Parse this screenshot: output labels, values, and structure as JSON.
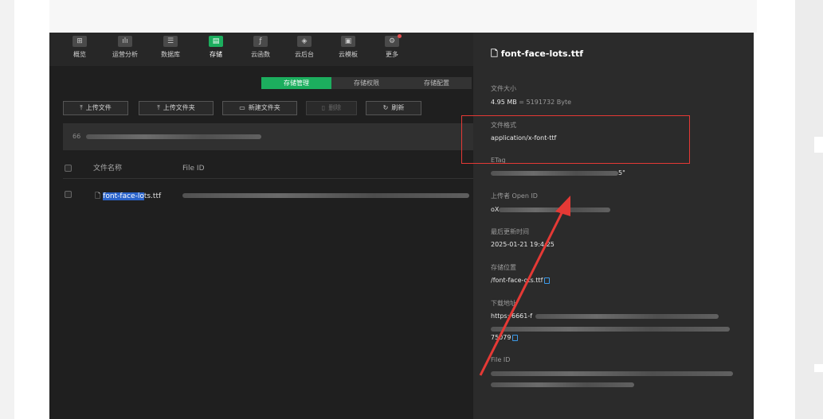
{
  "toolbar": {
    "items": [
      {
        "label": "概览",
        "icon": "grid-icon"
      },
      {
        "label": "运营分析",
        "icon": "bar-chart-icon"
      },
      {
        "label": "数据库",
        "icon": "database-icon"
      },
      {
        "label": "存储",
        "icon": "storage-icon",
        "active": true
      },
      {
        "label": "云函数",
        "icon": "function-icon"
      },
      {
        "label": "云后台",
        "icon": "cube-icon"
      },
      {
        "label": "云模板",
        "icon": "template-icon"
      },
      {
        "label": "更多",
        "icon": "more-icon"
      }
    ]
  },
  "subtabs": [
    "存储管理",
    "存储权限",
    "存储配置"
  ],
  "actions": {
    "upload_file": "上传文件",
    "upload_folder": "上传文件夹",
    "new_folder": "新建文件夹",
    "delete": "删除",
    "refresh": "刷新"
  },
  "path": "66",
  "table": {
    "headers": [
      "文件名称",
      "File ID"
    ],
    "rows": [
      {
        "name_highlight": "font-face-lo",
        "name_rest": "ts.ttf"
      }
    ]
  },
  "panel": {
    "title": "font-face-lots.ttf",
    "size_label": "文件大小",
    "size_value": "4.95 MB",
    "size_bytes": "= 5191732 Byte",
    "format_label": "文件格式",
    "format_value": "application/x-font-ttf",
    "etag_label": "ETag",
    "etag_tail": "5\"",
    "uploader_label": "上传者 Open ID",
    "uploader_prefix": "oX",
    "updated_label": "最后更新时间",
    "updated_value": "2025-01-21 19:4",
    "updated_tail": ":25",
    "location_label": "存储位置",
    "location_value": "/font-face-",
    "location_tail": "ots.ttf",
    "download_label": "下载地址",
    "download_prefix": "https:",
    "download_mid": "/6661-f",
    "download_suffix": "7",
    "download_end": "5079",
    "fileid_label": "File ID"
  },
  "colors": {
    "accent": "#1cae5e",
    "annotation": "#e53935"
  }
}
